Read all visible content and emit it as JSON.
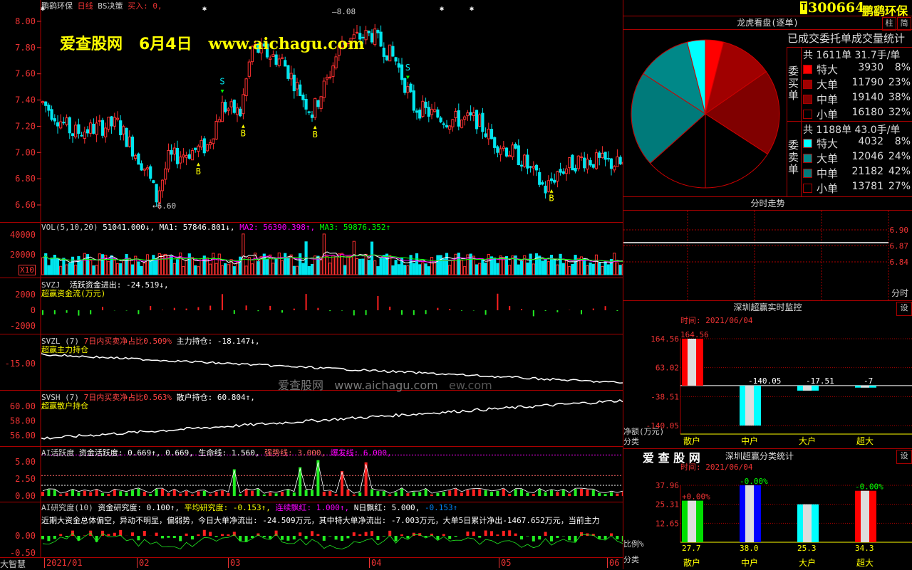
{
  "header": {
    "stock_name": "鹏鹞环保",
    "line_type": "日线",
    "strategy": "BS决策",
    "buy_label": "买入: 0,",
    "code": "300664",
    "code_badge": "T",
    "ticker_name": "鹏鹞环保",
    "tab_zhu": "柱",
    "tab_jian": "简"
  },
  "watermark": {
    "site": "爱查股网",
    "date": "6月4日",
    "url": "www.aichagu.com",
    "mid_site": "爱查股网",
    "mid_url": "www.aichagu.com",
    "mid_tail": "ew.com"
  },
  "price_axis": [
    "8.00",
    "7.80",
    "7.60",
    "7.40",
    "7.20",
    "7.00",
    "6.80",
    "6.60"
  ],
  "price_high_label": "8.08",
  "price_low_label": "6.60",
  "signals": [
    {
      "t": "S",
      "i": 60
    },
    {
      "t": "S",
      "i": 122
    },
    {
      "t": "B",
      "i": 52
    },
    {
      "t": "B",
      "i": 67
    },
    {
      "t": "B",
      "i": 91
    },
    {
      "t": "B",
      "i": 170
    }
  ],
  "vol": {
    "title": "VOL(5,10,20)",
    "val": "51041.000↓,",
    "ma1": "MA1: 57846.801↓,",
    "ma2": "MA2: 56390.398↑,",
    "ma3": "MA3: 59876.352↑",
    "axis": [
      "40000",
      "20000"
    ],
    "unit": "X10"
  },
  "svzj": {
    "title": "SVZJ",
    "label": "活跃资金进出: -24.519↓,",
    "subtitle": "超赢资金流(万元)",
    "axis": [
      "2000",
      "0",
      "-2000"
    ]
  },
  "svzl": {
    "title": "SVZL (7)",
    "label1": "7日内买卖净占比0.509%",
    "label2": "主力持仓: -18.147↓,",
    "subtitle": "超赢主力持仓",
    "axis": [
      "-15.00"
    ]
  },
  "svsh": {
    "title": "SVSH (7)",
    "label1": "7日内买卖净占比0.563%",
    "label2": "散户持仓: 60.804↑,",
    "subtitle": "超赢散户持仓",
    "axis": [
      "60.00",
      "58.00",
      "56.00"
    ]
  },
  "ai_active": {
    "title": "AI活跃度",
    "l1": "资金活跃度: 0.669↑, 0.669,",
    "l2": "生命线: 1.560,",
    "l3": "强势线: 3.000,",
    "l4": "爆发线: 6.000,",
    "axis": [
      "5.00",
      "2.50",
      "0.00"
    ]
  },
  "ai_research": {
    "title": "AI研究度(10)",
    "l1": "资金研究度: 0.100↑,",
    "l2": "平均研究度: -0.153↑,",
    "l3": "连续飘红: 1.000↑,",
    "l4": "N日飘红: 5.000,",
    "l5": "-0.153↑",
    "text": "近期大资金总体偏空，异动不明显，偏弱势，今日大单净流出: -24.509万元，其中特大单净流出: -7.003万元，大单5日累计净出-1467.652万元，当前主力",
    "axis": [
      "0.00",
      "-0.50"
    ]
  },
  "bottom_bar": {
    "left": "大智慧",
    "dates": [
      "2021/01",
      "02",
      "03",
      "04",
      "05",
      "06"
    ]
  },
  "longhu": {
    "title": "龙虎看盘(逐单)",
    "subtitle": "已成交委托单成交量统计",
    "buy_label": "委买单",
    "sell_label": "委卖单",
    "buy_total": "共 1611单 31.7手/单",
    "sell_total": "共 1188单 43.0手/单",
    "buy_rows": [
      {
        "name": "特大",
        "vol": "3930",
        "pct": "8%",
        "color": "#ff0000"
      },
      {
        "name": "大单",
        "vol": "11790",
        "pct": "23%",
        "color": "#a00000"
      },
      {
        "name": "中单",
        "vol": "19140",
        "pct": "38%",
        "color": "#800000"
      },
      {
        "name": "小单",
        "vol": "16180",
        "pct": "32%",
        "color": "#000000"
      }
    ],
    "sell_rows": [
      {
        "name": "特大",
        "vol": "4032",
        "pct": "8%",
        "color": "#00ffff"
      },
      {
        "name": "大单",
        "vol": "12046",
        "pct": "24%",
        "color": "#008888"
      },
      {
        "name": "中单",
        "vol": "21182",
        "pct": "42%",
        "color": "#007a7a"
      },
      {
        "name": "小单",
        "vol": "13781",
        "pct": "27%",
        "color": "#000000"
      }
    ]
  },
  "fenshi": {
    "title": "分时走势",
    "axis": [
      "6.90",
      "6.87",
      "6.84"
    ],
    "axis_label": "分时"
  },
  "monitor": {
    "title": "深圳超赢实时监控",
    "set": "设",
    "time": "时间: 2021/06/04",
    "axis": [
      "164.56",
      "63.02",
      "-38.51",
      "-140.05"
    ],
    "ylabel": "净额(万元)",
    "xlabel": "分类",
    "categories": [
      "散户",
      "中户",
      "大户",
      "超大"
    ],
    "values": [
      164.56,
      -140.05,
      -17.51,
      -7
    ],
    "value_labels": [
      "164.56",
      "-140.05",
      "-17.51",
      "-7"
    ]
  },
  "classify": {
    "brand": "爱 查 股 网",
    "title": "深圳超赢分类统计",
    "set": "设",
    "time": "时间: 2021/06/04",
    "axis": [
      "37.96",
      "25.31",
      "12.65"
    ],
    "ylabel": "比例%",
    "xlabel": "分类",
    "categories": [
      "散户",
      "中户",
      "大户",
      "超大"
    ],
    "values": [
      27.7,
      38.0,
      25.3,
      34.3
    ],
    "value_labels": [
      "27.7",
      "38.0",
      "25.3",
      "34.3"
    ],
    "change_labels": [
      "+0.00%",
      "-0.00%",
      "",
      "-0.00%"
    ],
    "colors": [
      "#00dd00",
      "#0000ff",
      "#00ffff",
      "#ff0000"
    ]
  }
}
